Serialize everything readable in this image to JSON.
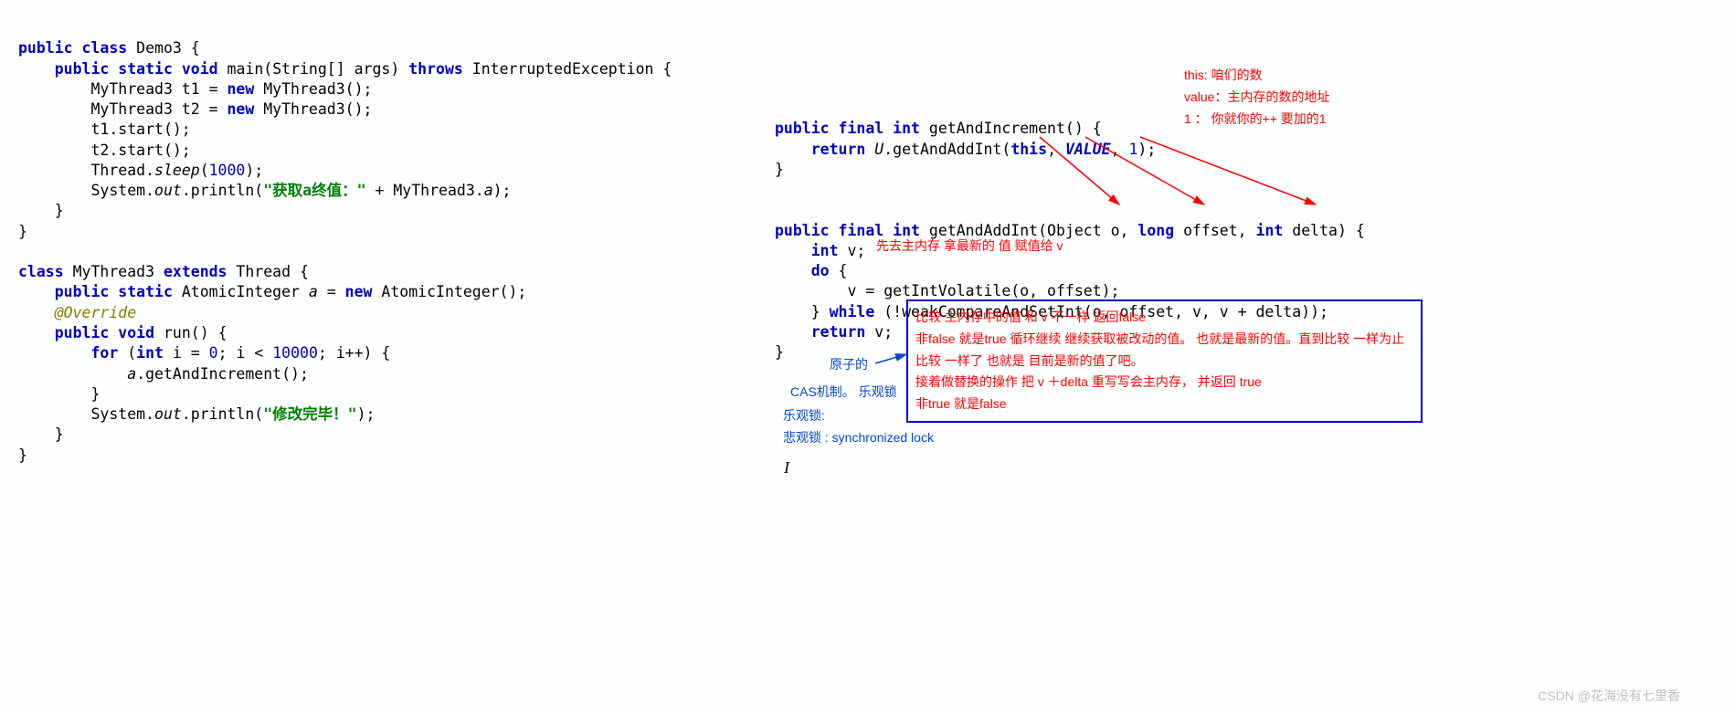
{
  "left_code": {
    "l1a": "public",
    "l1b": "class",
    "l1c": " Demo3 {",
    "l2a": "public",
    "l2b": "static",
    "l2c": "void",
    "l2d": " main(String[] args) ",
    "l2e": "throws",
    "l2f": " InterruptedException {",
    "l3a": "        MyThread3 t1 = ",
    "l3b": "new",
    "l3c": " MyThread3();",
    "l4a": "        MyThread3 t2 = ",
    "l4b": "new",
    "l4c": " MyThread3();",
    "l5": "        t1.start();",
    "l6": "        t2.start();",
    "l7a": "        Thread.",
    "l7b": "sleep",
    "l7c": "(",
    "l7d": "1000",
    "l7e": ");",
    "l8a": "        System.",
    "l8b": "out",
    "l8c": ".println(",
    "l8d": "\"获取a终值：\"",
    "l8e": " + MyThread3.",
    "l8f": "a",
    "l8g": ");",
    "l9": "    }",
    "l10": "}",
    "l12a": "class",
    "l12b": " MyThread3 ",
    "l12c": "extends",
    "l12d": " Thread {",
    "l13a": "public",
    "l13b": "static",
    "l13c": " AtomicInteger ",
    "l13d": "a",
    "l13e": " = ",
    "l13f": "new",
    "l13g": " AtomicInteger();",
    "l14": "@Override",
    "l15a": "public",
    "l15b": "void",
    "l15c": " run() {",
    "l16a": "for",
    "l16b": " (",
    "l16c": "int",
    "l16d": " i = ",
    "l16e": "0",
    "l16f": "; i < ",
    "l16g": "10000",
    "l16h": "; i++) {",
    "l17a": "            ",
    "l17b": "a",
    "l17c": ".getAndIncrement();",
    "l18": "        }",
    "l19a": "        System.",
    "l19b": "out",
    "l19c": ".println(",
    "l19d": "\"修改完毕！\"",
    "l19e": ");",
    "l20": "    }",
    "l21": "}"
  },
  "right_code": {
    "r1a": "public",
    "r1b": "final",
    "r1c": "int",
    "r1d": " getAndIncrement() {",
    "r2a": "return",
    "r2b": "U",
    "r2c": ".getAndAddInt(",
    "r2d": "this",
    "r2e": ", ",
    "r2f": "VALUE",
    "r2g": ", ",
    "r2h": "1",
    "r2i": ");",
    "r3": "}",
    "r5a": "public",
    "r5b": "final",
    "r5c": "int",
    "r5d": " getAndAddInt(Object o, ",
    "r5e": "long",
    "r5f": " offset, ",
    "r5g": "int",
    "r5h": " delta) {",
    "r6a": "int",
    "r6b": " v;",
    "r7a": "do",
    "r7b": " {",
    "r8": "        v = getIntVolatile(o, offset);",
    "r9a": "    } ",
    "r9b": "while",
    "r9c": " (!weakCompareAndSetInt(o, offset, v, v + delta));",
    "r10a": "return",
    "r10b": " v;",
    "r11": "}"
  },
  "red_notes": {
    "n1": "this: 咱们的数",
    "n2": "value：主内存的数的地址",
    "n3": "1 ： 你就你的++ 要加的1",
    "n4": "先去主内存 拿最新的 值 赋值给 v",
    "box_l1": "比较 主内存中的值 和 v   不一样  返回false",
    "box_l2": "   非false 就是true  循环继续  继续获取被改动的值。 也就是最新的值。直到比较 一样为止",
    "box_l3": "比较  一样了 也就是 目前是新的值了吧。",
    "box_l4": "  接着做替换的操作   把 v ＋delta  重写写会主内存，  并返回 true",
    "box_l5": "  非true 就是false"
  },
  "blue_notes": {
    "b1": "原子的",
    "b2": "CAS机制。  乐观锁",
    "b3": "乐观锁:",
    "b4": "悲观锁 :   synchronized lock"
  },
  "watermark": "CSDN @花海没有七里香"
}
